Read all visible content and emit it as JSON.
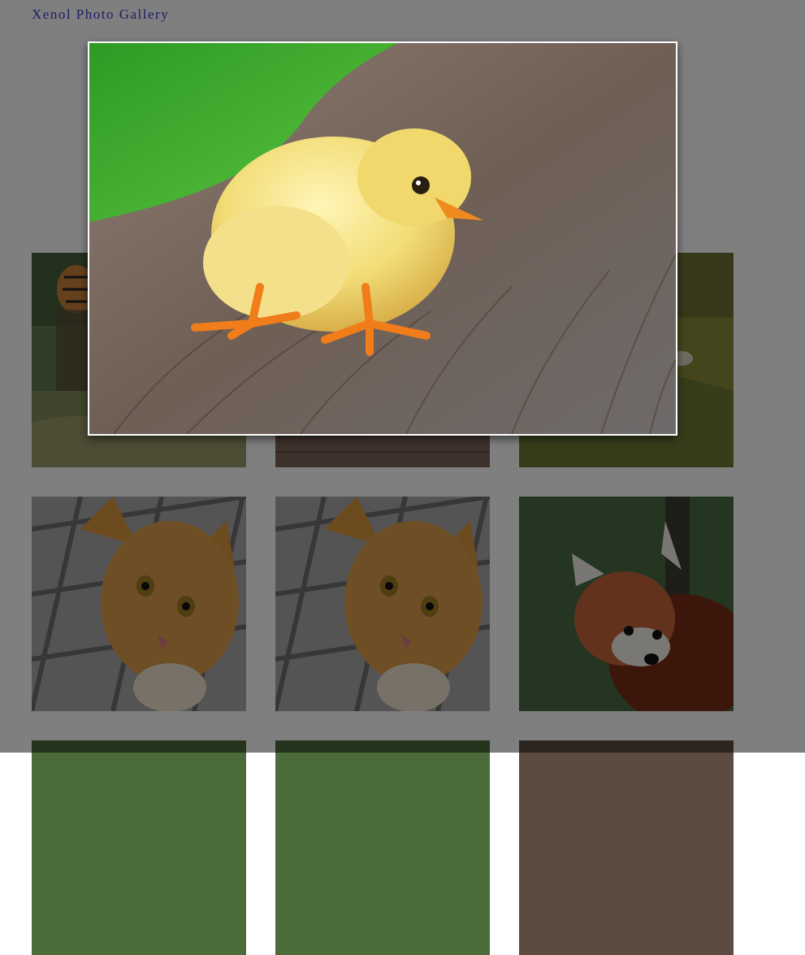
{
  "header": {
    "title": "Xenol Photo Gallery"
  },
  "gallery": {
    "items": [
      {
        "subject": "tiger"
      },
      {
        "subject": "wooden-plank"
      },
      {
        "subject": "grass-field"
      },
      {
        "subject": "orange-cat"
      },
      {
        "subject": "orange-cat"
      },
      {
        "subject": "red-panda"
      },
      {
        "subject": "forest"
      },
      {
        "subject": "forest"
      },
      {
        "subject": "ground"
      }
    ]
  },
  "lightbox": {
    "open": true,
    "subject": "yellow-chick-on-wood"
  },
  "colors": {
    "title": "#3a3ad0",
    "overlay": "rgba(0,0,0,0.5)",
    "frame": "#ffffff"
  }
}
